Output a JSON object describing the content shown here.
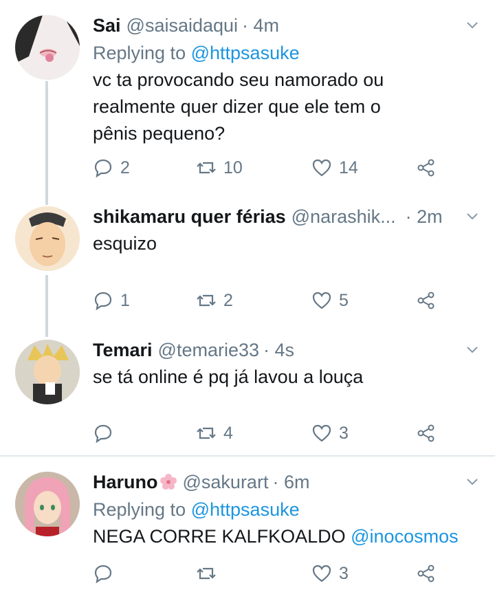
{
  "tweets": [
    {
      "name": "Sai",
      "handle": "@saisaidaqui",
      "time": "· 4m",
      "replying_prefix": "Replying to",
      "replying_to": "@httpsasuke",
      "text_lines": [
        "vc ta provocando seu namorado ou",
        "realmente quer dizer que ele tem o",
        "pênis pequeno?"
      ],
      "replies": "2",
      "retweets": "10",
      "likes": "14"
    },
    {
      "name": "shikamaru quer férias",
      "handle": "@narashik...",
      "time": "· 2m",
      "text": "esquizo",
      "replies": "1",
      "retweets": "2",
      "likes": "5"
    },
    {
      "name": "Temari",
      "handle": "@temarie33",
      "time": "· 4s",
      "text": "se tá online é pq já lavou a louça",
      "replies": "",
      "retweets": "4",
      "likes": "3"
    },
    {
      "name": "Haruno",
      "handle": "@sakurart",
      "time": "· 6m",
      "replying_prefix": "Replying to",
      "replying_to": "@httpsasuke",
      "text": "NEGA CORRE KALFKOALDO",
      "text_mention": "@inocosmos",
      "replies": "",
      "retweets": "",
      "likes": "3"
    }
  ],
  "icons": [
    "reply-icon",
    "retweet-icon",
    "like-icon",
    "share-icon",
    "chevron-down-icon",
    "cherry-blossom-icon"
  ],
  "colors": {
    "link": "#1b95e0",
    "muted": "#657786",
    "text": "#14171a",
    "line": "#cfd9de"
  }
}
